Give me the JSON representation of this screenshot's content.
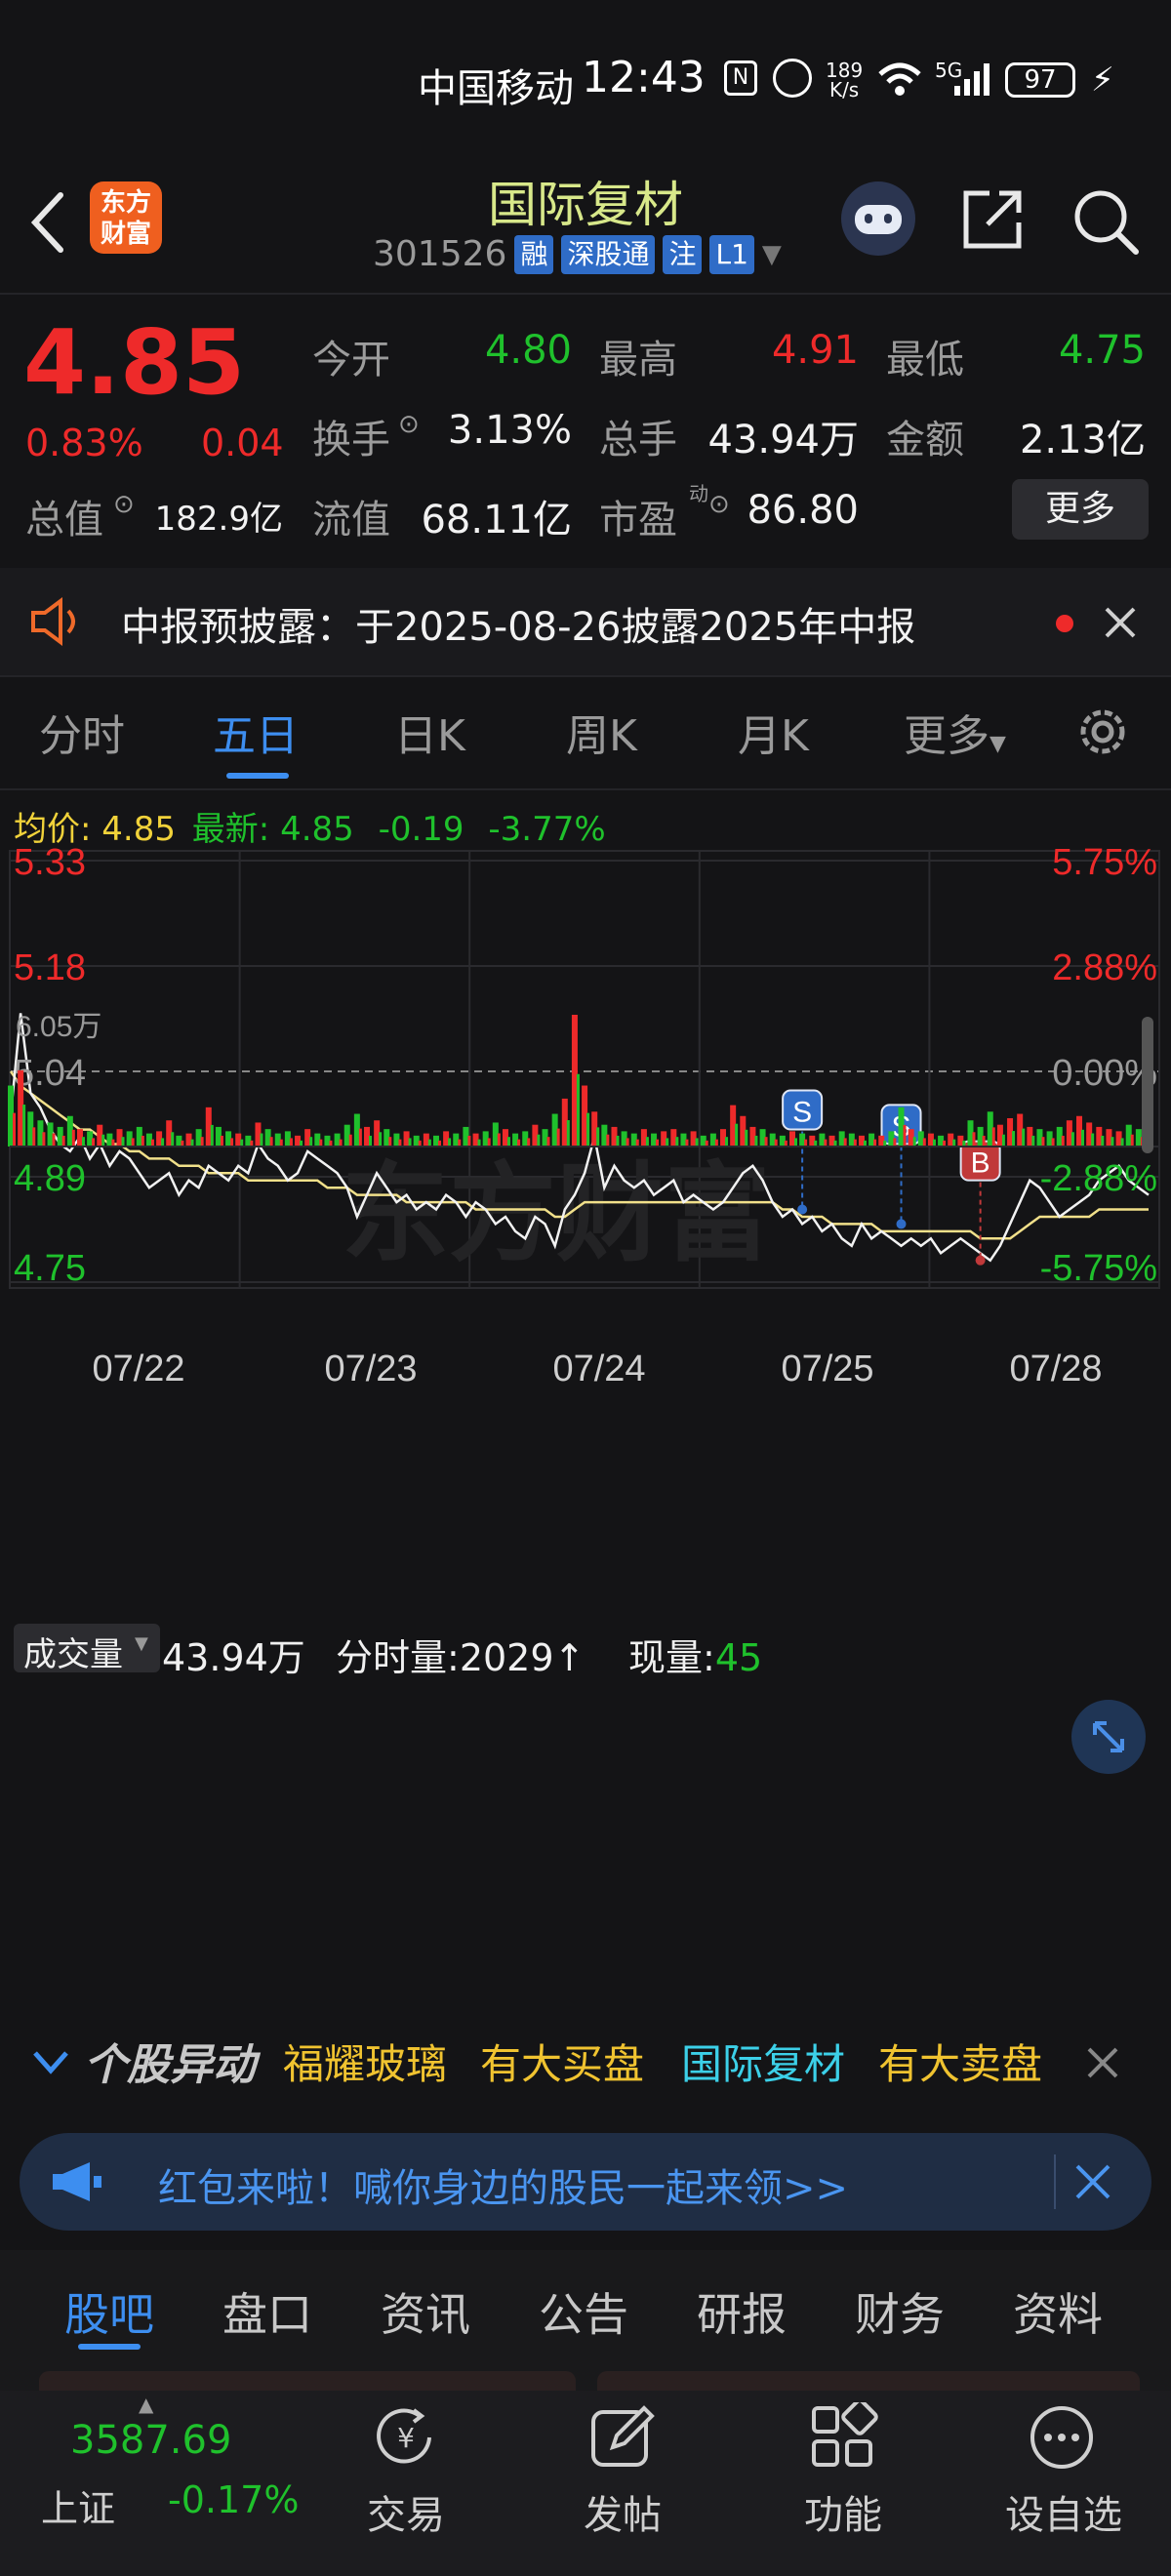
{
  "status_bar": {
    "carrier": "中国移动",
    "time": "12:43",
    "net_speed_value": "189",
    "net_speed_unit": "K/s",
    "network": "5G",
    "battery": "97"
  },
  "header": {
    "logo_text": "东方财富",
    "stock_name": "国际复材",
    "stock_code": "301526",
    "tags": [
      "融",
      "深股通",
      "注",
      "L1"
    ]
  },
  "quote": {
    "price": "4.85",
    "change_pct": "0.83%",
    "change_abs": "0.04",
    "fields": {
      "open_label": "今开",
      "open_value": "4.80",
      "high_label": "最高",
      "high_value": "4.91",
      "low_label": "最低",
      "low_value": "4.75",
      "turnover_label": "换手",
      "turnover_value": "3.13%",
      "volume_label": "总手",
      "volume_value": "43.94万",
      "amount_label": "金额",
      "amount_value": "2.13亿",
      "mktcap_label": "总值",
      "mktcap_value": "182.9亿",
      "float_label": "流值",
      "float_value": "68.11亿",
      "pe_label": "市盈",
      "pe_sup": "动",
      "pe_value": "86.80"
    },
    "more_label": "更多"
  },
  "notice": {
    "text": "中报预披露：于2025-08-26披露2025年中报"
  },
  "tabs": [
    "分时",
    "五日",
    "日K",
    "周K",
    "月K",
    "更多"
  ],
  "active_tab": "五日",
  "info_line": {
    "avg_label": "均价:",
    "avg_value": "4.85",
    "latest_label": "最新:",
    "latest_value": "4.85",
    "change": "-0.19",
    "change_pct": "-3.77%"
  },
  "colors": {
    "up": "#ee2a2a",
    "down": "#1fc12c",
    "accent": "#3d8ef0",
    "avg_line": "#f1e08a",
    "price_line": "#f2f2f2"
  },
  "chart_data": {
    "type": "line",
    "x_labels": [
      "07/22",
      "07/23",
      "07/24",
      "07/25",
      "07/28"
    ],
    "y_ticks_left": [
      "5.33",
      "5.18",
      "5.04",
      "4.89",
      "4.75"
    ],
    "y_ticks_right": [
      "5.75%",
      "2.88%",
      "0.00%",
      "-2.88%",
      "-5.75%"
    ],
    "ylim": [
      4.75,
      5.33
    ],
    "prev_close": 5.04,
    "watermark": "东方财富",
    "series": [
      {
        "values": [
          4.98,
          5.12,
          5.01,
          4.99,
          4.96,
          4.94,
          4.93,
          4.95,
          4.92,
          4.94,
          4.91,
          4.93,
          4.92,
          4.9,
          4.88,
          4.89,
          4.9,
          4.87,
          4.89,
          4.88,
          4.91,
          4.9,
          4.89,
          4.91,
          4.9,
          4.94,
          4.92,
          4.91,
          4.89,
          4.9,
          4.93,
          4.92,
          4.91,
          4.9,
          4.88,
          4.84,
          4.87,
          4.9,
          4.88,
          4.86,
          4.87,
          4.85,
          4.86,
          4.85,
          4.87,
          4.86,
          4.84,
          4.86,
          4.85,
          4.83,
          4.84,
          4.82,
          4.81,
          4.84,
          4.83,
          4.8,
          4.85,
          4.87,
          4.9,
          4.95,
          4.88,
          4.91,
          4.89,
          4.88,
          4.89,
          4.87,
          4.88,
          4.89,
          4.86,
          4.87,
          4.86,
          4.85,
          4.86,
          4.88,
          4.9,
          4.91,
          4.89,
          4.86,
          4.84,
          4.85,
          4.83,
          4.84,
          4.82,
          4.83,
          4.81,
          4.8,
          4.83,
          4.81,
          4.82,
          4.81,
          4.8,
          4.81,
          4.8,
          4.81,
          4.79,
          4.8,
          4.81,
          4.8,
          4.79,
          4.78,
          4.8,
          4.83,
          4.86,
          4.89,
          4.88,
          4.86,
          4.84,
          4.85,
          4.86,
          4.87,
          4.89,
          4.9,
          4.91,
          4.89,
          4.88,
          4.87
        ]
      },
      {
        "values": [
          5.04,
          5.02,
          5.01,
          5.0,
          4.99,
          4.98,
          4.97,
          4.96,
          4.96,
          4.95,
          4.94,
          4.94,
          4.93,
          4.93,
          4.92,
          4.92,
          4.92,
          4.91,
          4.91,
          4.91,
          4.9,
          4.9,
          4.9,
          4.9,
          4.89,
          4.89,
          4.89,
          4.89,
          4.89,
          4.89,
          4.89,
          4.89,
          4.88,
          4.88,
          4.88,
          4.87,
          4.87,
          4.87,
          4.87,
          4.87,
          4.86,
          4.86,
          4.86,
          4.86,
          4.86,
          4.86,
          4.86,
          4.85,
          4.85,
          4.85,
          4.85,
          4.85,
          4.85,
          4.85,
          4.85,
          4.84,
          4.84,
          4.85,
          4.86,
          4.86,
          4.86,
          4.86,
          4.86,
          4.86,
          4.86,
          4.86,
          4.86,
          4.86,
          4.86,
          4.86,
          4.86,
          4.86,
          4.86,
          4.86,
          4.86,
          4.86,
          4.86,
          4.86,
          4.85,
          4.85,
          4.84,
          4.84,
          4.84,
          4.83,
          4.83,
          4.83,
          4.83,
          4.83,
          4.82,
          4.82,
          4.82,
          4.82,
          4.82,
          4.82,
          4.82,
          4.82,
          4.82,
          4.82,
          4.81,
          4.81,
          4.81,
          4.81,
          4.82,
          4.83,
          4.84,
          4.84,
          4.84,
          4.84,
          4.84,
          4.84,
          4.85,
          4.85,
          4.85,
          4.85,
          4.85,
          4.85
        ]
      }
    ],
    "markers": [
      {
        "label": "S",
        "x_index": 80,
        "value": 4.85
      },
      {
        "label": "S",
        "x_index": 90,
        "value": 4.83
      },
      {
        "label": "B",
        "x_index": 98,
        "value": 4.78
      }
    ],
    "volume": {
      "max_label": "6.05万",
      "values": [
        2.8,
        3.5,
        1.6,
        1.2,
        1.1,
        0.9,
        1.4,
        0.8,
        0.7,
        1.0,
        0.6,
        0.8,
        0.7,
        0.9,
        0.6,
        0.7,
        1.2,
        0.5,
        0.6,
        0.8,
        1.8,
        0.9,
        0.7,
        0.6,
        0.5,
        1.1,
        0.8,
        0.6,
        0.7,
        0.5,
        0.8,
        0.6,
        0.5,
        0.6,
        1.0,
        1.5,
        0.9,
        1.2,
        0.8,
        0.6,
        0.7,
        0.5,
        0.6,
        0.5,
        0.7,
        0.6,
        0.9,
        0.6,
        0.7,
        1.1,
        0.8,
        0.6,
        0.7,
        1.0,
        0.8,
        1.5,
        2.2,
        6.05,
        2.8,
        1.6,
        1.0,
        0.9,
        0.7,
        0.6,
        0.8,
        0.6,
        0.7,
        0.8,
        0.6,
        0.7,
        0.5,
        0.6,
        0.8,
        1.9,
        1.4,
        0.9,
        0.8,
        0.6,
        0.5,
        0.7,
        0.6,
        0.5,
        0.6,
        0.5,
        0.7,
        0.6,
        0.5,
        0.6,
        0.5,
        0.7,
        1.8,
        0.8,
        0.7,
        0.6,
        0.5,
        0.6,
        0.5,
        1.2,
        0.9,
        1.6,
        1.0,
        1.3,
        1.5,
        0.9,
        0.8,
        0.7,
        0.9,
        1.2,
        1.4,
        1.1,
        0.9,
        0.8,
        0.7,
        1.0,
        0.8,
        0.6
      ]
    }
  },
  "volume_header": {
    "selector_label": "成交量",
    "total": "43.94万",
    "tick_vol_label": "分时量:",
    "tick_vol_value": "2029",
    "current_label": "现量:",
    "current_value": "45"
  },
  "movement_alert": {
    "title": "个股异动",
    "item1_name": "福耀玻璃",
    "item1_action": "有大买盘",
    "item2_name": "国际复材",
    "item2_action": "有大卖盘"
  },
  "red_packet": {
    "text": "红包来啦！喊你身边的股民一起来领>>"
  },
  "bottom_tabs": [
    "股吧",
    "盘口",
    "资讯",
    "公告",
    "研报",
    "财务",
    "资料"
  ],
  "nav": {
    "index_value": "3587.69",
    "index_name": "上证",
    "index_change": "-0.17%",
    "items": [
      "交易",
      "发帖",
      "功能",
      "设自选"
    ]
  }
}
